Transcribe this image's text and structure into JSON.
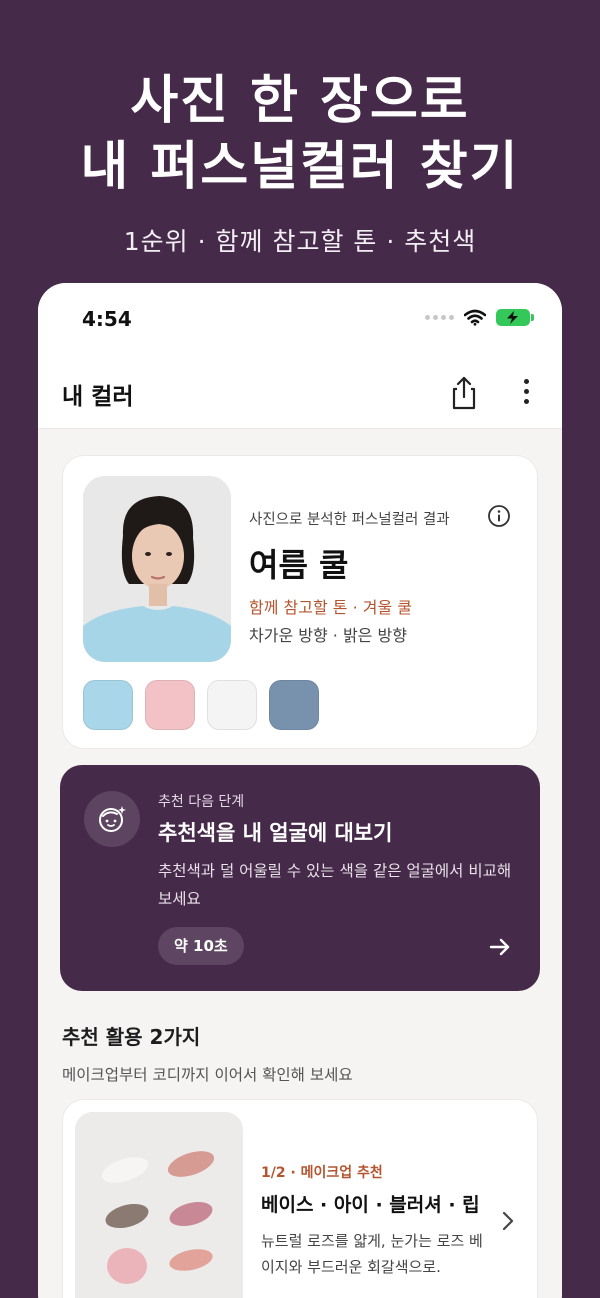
{
  "headline": {
    "line1": "사진 한 장으로",
    "line2": "내 퍼스널컬러 찾기",
    "subtitle": "1순위 · 함께 참고할 톤 · 추천색"
  },
  "status_bar": {
    "time": "4:54",
    "icons": [
      "signal-dots-icon",
      "wifi-icon",
      "battery-charging-icon"
    ]
  },
  "nav": {
    "title": "내 컬러",
    "icons": [
      "share-icon",
      "more-vertical-icon"
    ]
  },
  "result": {
    "caption": "사진으로 분석한 퍼스널컬러 결과",
    "season": "여름 쿨",
    "related": "함께 참고할 톤 · 겨울 쿨",
    "direction": "차가운 방향 · 밝은 방향",
    "swatches": [
      "#a9d6e8",
      "#f2c2c6",
      "#f4f4f4",
      "#7892ae"
    ]
  },
  "next_step": {
    "kicker": "추천 다음 단계",
    "title": "추천색을 내 얼굴에 대보기",
    "description": "추천색과 덜 어울릴 수 있는 색을 같은 얼굴에서 비교해 보세요",
    "duration": "약 10초",
    "icon": "face-sparkle-icon"
  },
  "recommendations": {
    "title": "추천 활용 2가지",
    "description": "메이크업부터 코디까지 이어서 확인해 보세요",
    "items": [
      {
        "kicker": "1/2 · 메이크업 추천",
        "title": "베이스 · 아이 · 블러셔 · 립",
        "description": "뉴트럴 로즈를 얇게, 눈가는 로즈 베이지와 부드러운 회갈색으로."
      }
    ]
  },
  "colors": {
    "background": "#452a49",
    "accent": "#b4552f",
    "battery": "#34c759"
  }
}
